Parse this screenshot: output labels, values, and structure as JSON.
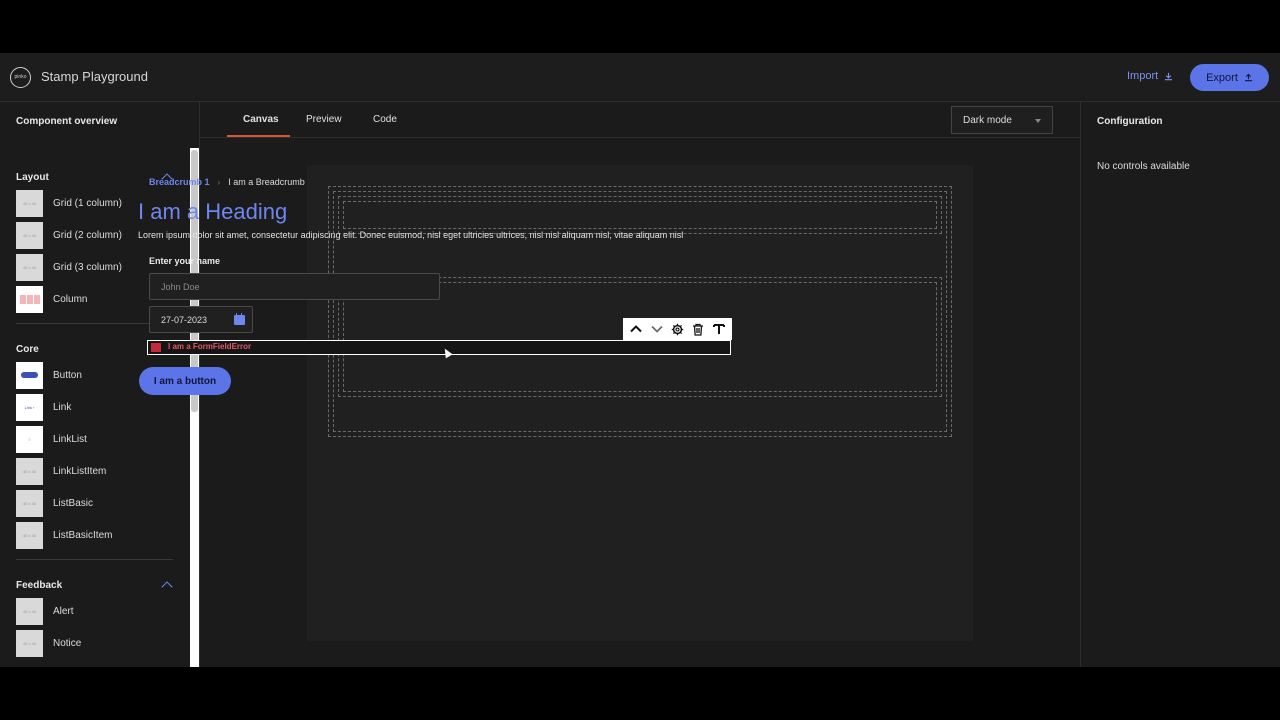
{
  "app": {
    "title": "Stamp Playground",
    "logo_text": "pinko"
  },
  "header": {
    "import_label": "Import",
    "export_label": "Export"
  },
  "sidebar": {
    "title": "Component overview",
    "sections": [
      {
        "label": "Layout",
        "items": [
          "Grid (1 column)",
          "Grid (2 column)",
          "Grid (3 column)",
          "Column"
        ]
      },
      {
        "label": "Core",
        "items": [
          "Button",
          "Link",
          "LinkList",
          "LinkListItem",
          "ListBasic",
          "ListBasicItem"
        ]
      },
      {
        "label": "Feedback",
        "items": [
          "Alert",
          "Notice"
        ]
      }
    ],
    "placeholder_thumb": "40 x 40"
  },
  "tabs": [
    "Canvas",
    "Preview",
    "Code"
  ],
  "mode_select": {
    "value": "Dark mode"
  },
  "canvas": {
    "breadcrumb": {
      "link": "Breadcrumb 1",
      "current": "I am a Breadcrumb"
    },
    "heading": "I am a Heading",
    "paragraph": "Lorem ipsum dolor sit amet, consectetur adipiscing elit. Donec euismod, nisl eget ultricies ultrices, nisl nisl aliquam nisl, vitae aliquam nisl",
    "name_field": {
      "label": "Enter your name",
      "placeholder": "John Doe"
    },
    "date_field": {
      "value": "27-07-2023"
    },
    "error_text": "I am a FormFieldError",
    "button_label": "I am a button",
    "toolbar_icons": [
      "move-up-icon",
      "move-down-icon",
      "settings-icon",
      "delete-icon",
      "text-icon"
    ]
  },
  "config": {
    "title": "Configuration",
    "empty": "No controls available"
  },
  "colors": {
    "accent": "#5b74e8",
    "tab_active": "#d6582f",
    "error": "#e2566b"
  }
}
